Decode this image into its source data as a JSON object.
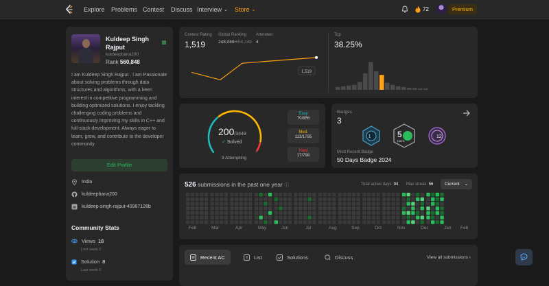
{
  "nav": {
    "items": [
      "Explore",
      "Problems",
      "Contest",
      "Discuss",
      "Interview"
    ],
    "store": "Store",
    "streak": "72",
    "premium": "Premium"
  },
  "profile": {
    "name": "Kuldeep Singh Rajput",
    "username": "kuldeepbana200",
    "rank_label": "Rank",
    "rank_value": "560,848",
    "bio": "I am Kuldeep Singh Rajput . I am Passionate about solving problems through data structures and algorithms, with a keen interest in competitive programming and building optimized solutions. I enjoy tackling challenging coding problems and continuously improving my skills in C++ and full-stack development. Always eager to learn, grow, and contribute to the developer community",
    "edit_label": "Edit Profile",
    "location": "India",
    "github": "kuldeepbana200",
    "linkedin": "kuldeep-singh-rajput-40987128b"
  },
  "community": {
    "title": "Community Stats",
    "views_label": "Views",
    "views": "18",
    "views_sub": "Last week 0",
    "solution_label": "Solution",
    "solution": "8",
    "solution_sub": "Last week 0"
  },
  "contest": {
    "rating_label": "Contest Rating",
    "rating": "1,519",
    "global_label": "Global Ranking",
    "global_rank": "248,069",
    "global_total": "/658,249",
    "attended_label": "Attended",
    "attended": "4",
    "tooltip": "1,519",
    "rating_history": [
      1470,
      1445,
      1500,
      1519
    ],
    "top_label": "Top",
    "top_value": "38.25%",
    "histogram": [
      0.08,
      0.1,
      0.12,
      0.14,
      0.22,
      0.46,
      0.78,
      0.52,
      0.42,
      0.2,
      0.14,
      0.1,
      0.08,
      0.06,
      0.05,
      0.04,
      0.04
    ],
    "highlight_index": 8
  },
  "solved": {
    "count": "200",
    "total": "/3449",
    "solved_label": "Solved",
    "attempting": "9 Attempting",
    "easy_label": "Easy",
    "easy": "70/856",
    "medium_label": "Med.",
    "medium": "113/1795",
    "hard_label": "Hard",
    "hard": "17/798",
    "easy_frac": 0.35,
    "medium_frac": 0.565,
    "hard_frac": 0.085
  },
  "badges": {
    "label": "Badges",
    "count": "3",
    "recent_label": "Most Recent Badge",
    "recent": "50 Days Badge 2024",
    "b2_text": "DAYS",
    "b3_text": "12"
  },
  "submissions": {
    "count": "526",
    "text": "submissions in the past one year",
    "active_label": "Total active days:",
    "active": "94",
    "streak_label": "Max streak:",
    "streak": "56",
    "period": "Current",
    "months": [
      "Feb",
      "Mar",
      "Apr",
      "May",
      "Jun",
      "Jul",
      "Aug",
      "Sep",
      "Oct",
      "Nov",
      "Dec",
      "Jan",
      "Feb"
    ]
  },
  "recent": {
    "tabs": [
      "Recent AC",
      "List",
      "Solutions",
      "Discuss"
    ],
    "view_all": "View all submissions"
  },
  "colors": {
    "accent": "#ffa116",
    "easy": "#1cbaba",
    "medium": "#ffb700",
    "hard": "#f63737",
    "green": "#2cbb5d"
  }
}
